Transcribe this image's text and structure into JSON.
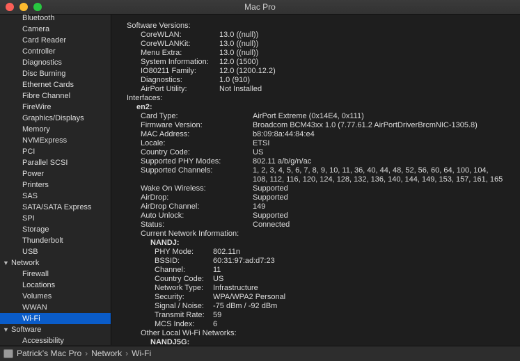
{
  "window": {
    "title": "Mac Pro"
  },
  "sidebar": {
    "items": [
      {
        "label": "Bluetooth"
      },
      {
        "label": "Camera"
      },
      {
        "label": "Card Reader"
      },
      {
        "label": "Controller"
      },
      {
        "label": "Diagnostics"
      },
      {
        "label": "Disc Burning"
      },
      {
        "label": "Ethernet Cards"
      },
      {
        "label": "Fibre Channel"
      },
      {
        "label": "FireWire"
      },
      {
        "label": "Graphics/Displays"
      },
      {
        "label": "Memory"
      },
      {
        "label": "NVMExpress"
      },
      {
        "label": "PCI"
      },
      {
        "label": "Parallel SCSI"
      },
      {
        "label": "Power"
      },
      {
        "label": "Printers"
      },
      {
        "label": "SAS"
      },
      {
        "label": "SATA/SATA Express"
      },
      {
        "label": "SPI"
      },
      {
        "label": "Storage"
      },
      {
        "label": "Thunderbolt"
      },
      {
        "label": "USB"
      },
      {
        "label": "Network",
        "group": true
      },
      {
        "label": "Firewall"
      },
      {
        "label": "Locations"
      },
      {
        "label": "Volumes"
      },
      {
        "label": "WWAN"
      },
      {
        "label": "Wi-Fi",
        "selected": true
      },
      {
        "label": "Software",
        "group": true
      },
      {
        "label": "Accessibility"
      }
    ],
    "expanded_marker": "▼"
  },
  "content": {
    "lines": [
      {
        "k": "Software Versions:"
      },
      {
        "k": "CoreWLAN:",
        "v": "13.0 ((null))"
      },
      {
        "k": "CoreWLANKit:",
        "v": "13.0 ((null))"
      },
      {
        "k": "Menu Extra:",
        "v": "13.0 ((null))"
      },
      {
        "k": "System Information:",
        "v": "12.0 (1500)"
      },
      {
        "k": "IO80211 Family:",
        "v": "12.0 (1200.12.2)"
      },
      {
        "k": "Diagnostics:",
        "v": "1.0 (910)"
      },
      {
        "k": "AirPort Utility:",
        "v": "Not Installed"
      },
      {
        "k": "Interfaces:"
      },
      {
        "k": "en2:"
      },
      {
        "k": "Card Type:",
        "v": "AirPort Extreme  (0x14E4, 0x111)"
      },
      {
        "k": "Firmware Version:",
        "v": "Broadcom BCM43xx 1.0 (7.77.61.2 AirPortDriverBrcmNIC-1305.8)"
      },
      {
        "k": "MAC Address:",
        "v": "b8:09:8a:44:84:e4"
      },
      {
        "k": "Locale:",
        "v": "ETSI"
      },
      {
        "k": "Country Code:",
        "v": "US"
      },
      {
        "k": "Supported PHY Modes:",
        "v": "802.11 a/b/g/n/ac"
      },
      {
        "k": "Supported Channels:",
        "v": "1, 2, 3, 4, 5, 6, 7, 8, 9, 10, 11, 36, 40, 44, 48, 52, 56, 60, 64, 100, 104,"
      },
      {
        "v": "108, 112, 116, 120, 124, 128, 132, 136, 140, 144, 149, 153, 157, 161, 165"
      },
      {
        "k": "Wake On Wireless:",
        "v": "Supported"
      },
      {
        "k": "AirDrop:",
        "v": "Supported"
      },
      {
        "k": "AirDrop Channel:",
        "v": "149"
      },
      {
        "k": "Auto Unlock:",
        "v": "Supported"
      },
      {
        "k": "Status:",
        "v": "Connected"
      },
      {
        "k": "Current Network Information:"
      },
      {
        "k": "NANDJ:"
      },
      {
        "k": "PHY Mode:",
        "v": "802.11n"
      },
      {
        "k": "BSSID:",
        "v": "60:31:97:ad:d7:23"
      },
      {
        "k": "Channel:",
        "v": "11"
      },
      {
        "k": "Country Code:",
        "v": "US"
      },
      {
        "k": "Network Type:",
        "v": "Infrastructure"
      },
      {
        "k": "Security:",
        "v": "WPA/WPA2 Personal"
      },
      {
        "k": "Signal / Noise:",
        "v": "-75 dBm / -92 dBm"
      },
      {
        "k": "Transmit Rate:",
        "v": "59"
      },
      {
        "k": "MCS Index:",
        "v": "6"
      },
      {
        "k": "Other Local Wi-Fi Networks:"
      },
      {
        "k": "NANDJ5G:"
      }
    ]
  },
  "statusbar": {
    "crumbs": [
      "Patrick’s Mac Pro",
      "Network",
      "Wi-Fi"
    ],
    "separator": "›"
  }
}
